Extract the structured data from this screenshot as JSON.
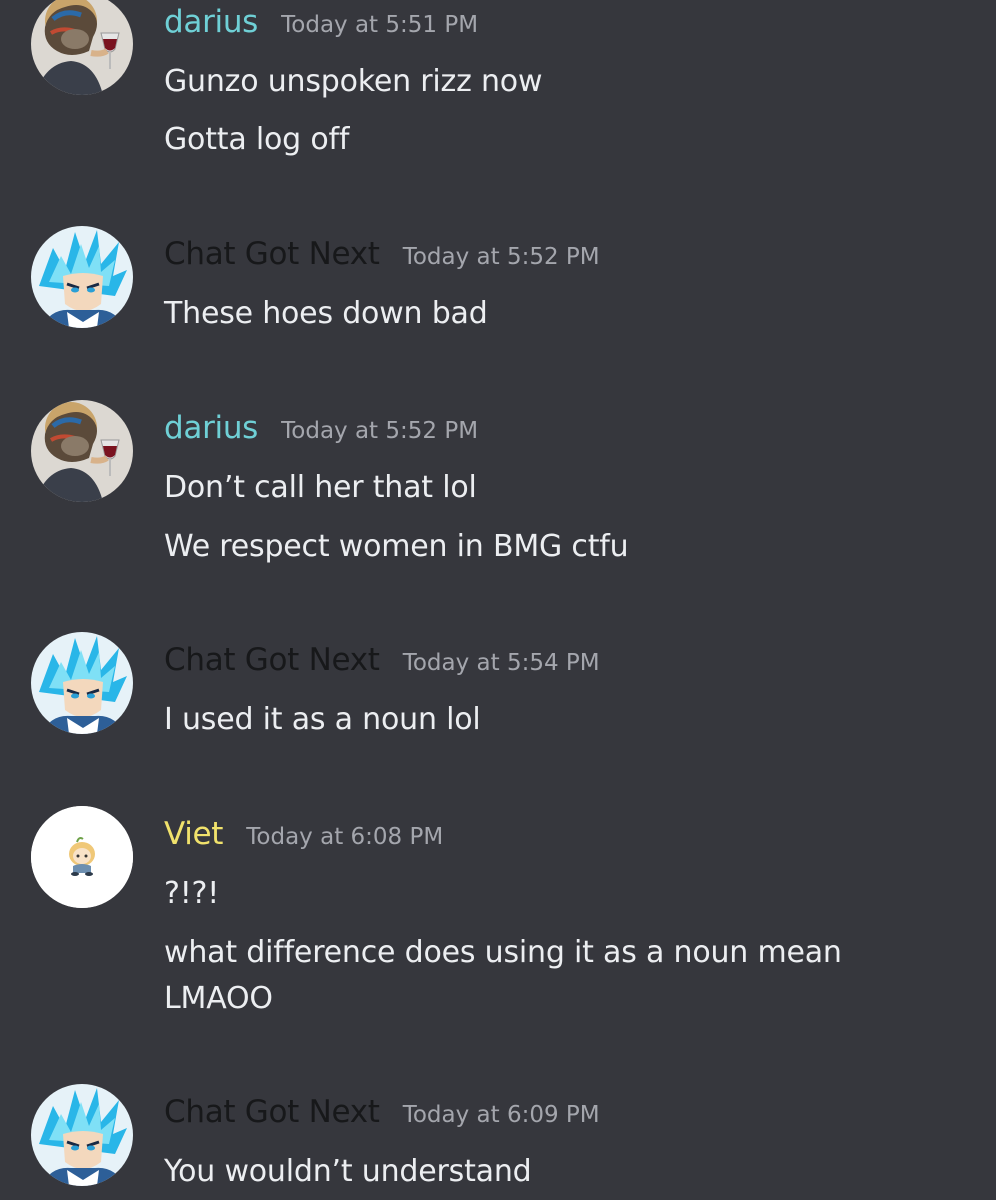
{
  "colors": {
    "background": "#36373d",
    "darius": "#6fd0d6",
    "chat_got_next": "#17181a",
    "viet": "#f1e26c",
    "timestamp": "#a4a6ad",
    "text": "#eceef1"
  },
  "messages": [
    {
      "author": "darius",
      "time": "Today at 5:51 PM",
      "avatar_icon": "ape-with-wine-avatar",
      "lines": [
        "Gunzo unspoken rizz now",
        "Gotta log off"
      ]
    },
    {
      "author": "Chat Got Next",
      "time": "Today at 5:52 PM",
      "avatar_icon": "blue-haired-anime-avatar",
      "lines": [
        "These hoes down bad"
      ]
    },
    {
      "author": "darius",
      "time": "Today at 5:52 PM",
      "avatar_icon": "ape-with-wine-avatar",
      "lines": [
        "Don’t call her that lol",
        "We respect women in BMG ctfu"
      ]
    },
    {
      "author": "Chat Got Next",
      "time": "Today at 5:54 PM",
      "avatar_icon": "blue-haired-anime-avatar",
      "lines": [
        "I used it as a noun lol"
      ]
    },
    {
      "author": "Viet",
      "time": "Today at 6:08 PM",
      "avatar_icon": "chibi-character-avatar",
      "lines": [
        "?!?!",
        "what difference does using it as a noun  mean",
        "LMAOO"
      ]
    },
    {
      "author": "Chat Got Next",
      "time": "Today at 6:09 PM",
      "avatar_icon": "blue-haired-anime-avatar",
      "lines": [
        "You wouldn’t understand"
      ]
    }
  ]
}
